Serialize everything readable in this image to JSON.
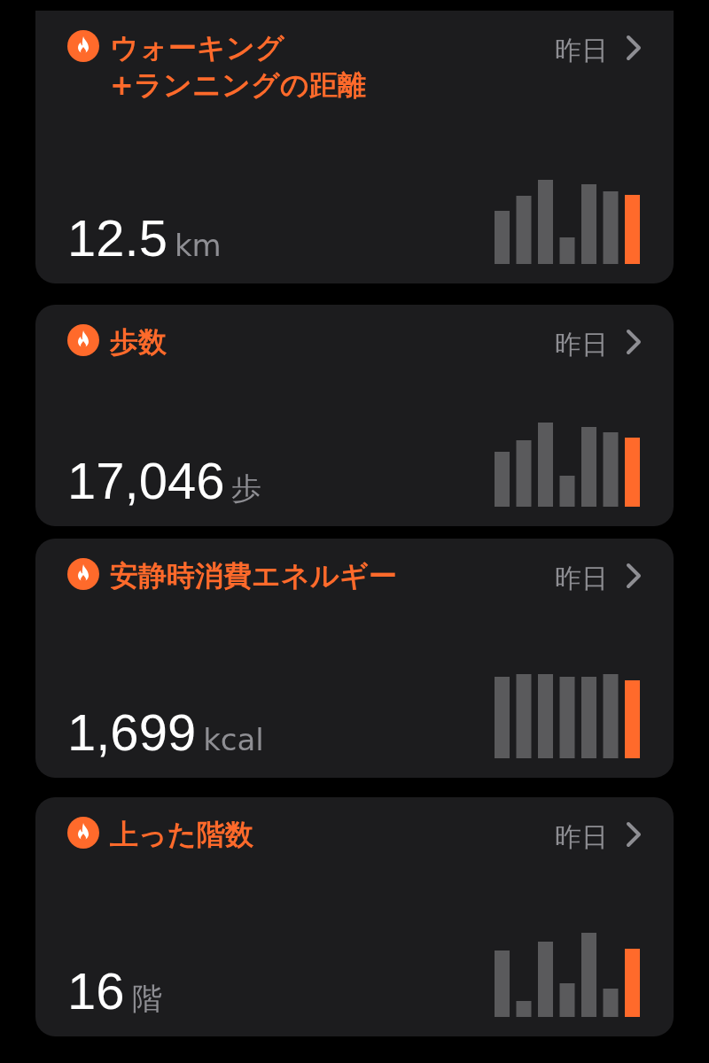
{
  "cards": [
    {
      "title_lines": [
        "ウォーキング",
        "+ランニングの距離"
      ],
      "period": "昨日",
      "value": "12.5",
      "unit": "km"
    },
    {
      "title_lines": [
        "歩数"
      ],
      "period": "昨日",
      "value": "17,046",
      "unit": "歩"
    },
    {
      "title_lines": [
        "安静時消費エネルギー"
      ],
      "period": "昨日",
      "value": "1,699",
      "unit": "kcal"
    },
    {
      "title_lines": [
        "上った階数"
      ],
      "period": "昨日",
      "value": "16",
      "unit": "階"
    }
  ]
}
